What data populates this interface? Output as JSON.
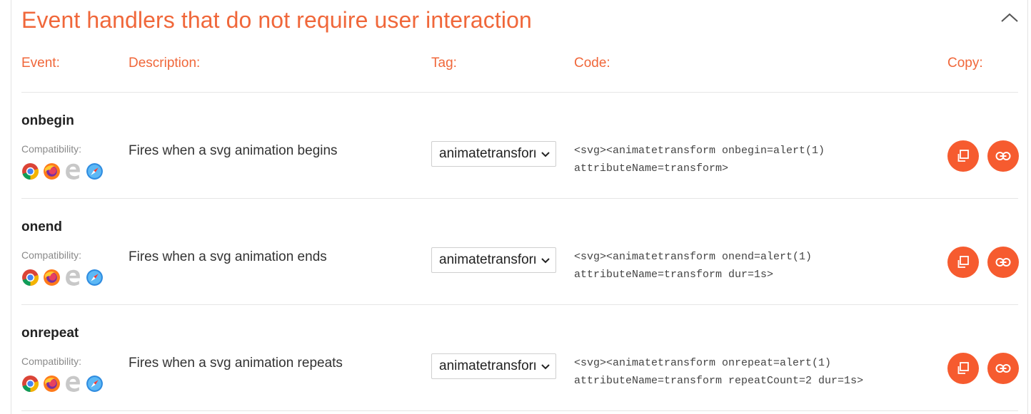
{
  "section": {
    "title": "Event handlers that do not require user interaction",
    "collapse_icon": "chevron-up-icon"
  },
  "columns": {
    "event": "Event:",
    "description": "Description:",
    "tag": "Tag:",
    "code": "Code:",
    "copy": "Copy:"
  },
  "compat_label": "Compatibility:",
  "browsers": [
    "chrome-icon",
    "firefox-icon",
    "edge-icon",
    "safari-icon"
  ],
  "colors": {
    "accent": "#f0673a",
    "button": "#f65b2f",
    "edge_disabled": "#c8c8c8"
  },
  "rows": [
    {
      "event": "onbegin",
      "description": "Fires when a svg animation begins",
      "tag": "animatetransform",
      "code_line1": "<svg><animatetransform onbegin=alert(1)",
      "code_line2": "attributeName=transform>"
    },
    {
      "event": "onend",
      "description": "Fires when a svg animation ends",
      "tag": "animatetransform",
      "code_line1": "<svg><animatetransform onend=alert(1)",
      "code_line2": "attributeName=transform dur=1s>"
    },
    {
      "event": "onrepeat",
      "description": "Fires when a svg animation repeats",
      "tag": "animatetransform",
      "code_line1": "<svg><animatetransform onrepeat=alert(1)",
      "code_line2": "attributeName=transform repeatCount=2 dur=1s>"
    }
  ]
}
